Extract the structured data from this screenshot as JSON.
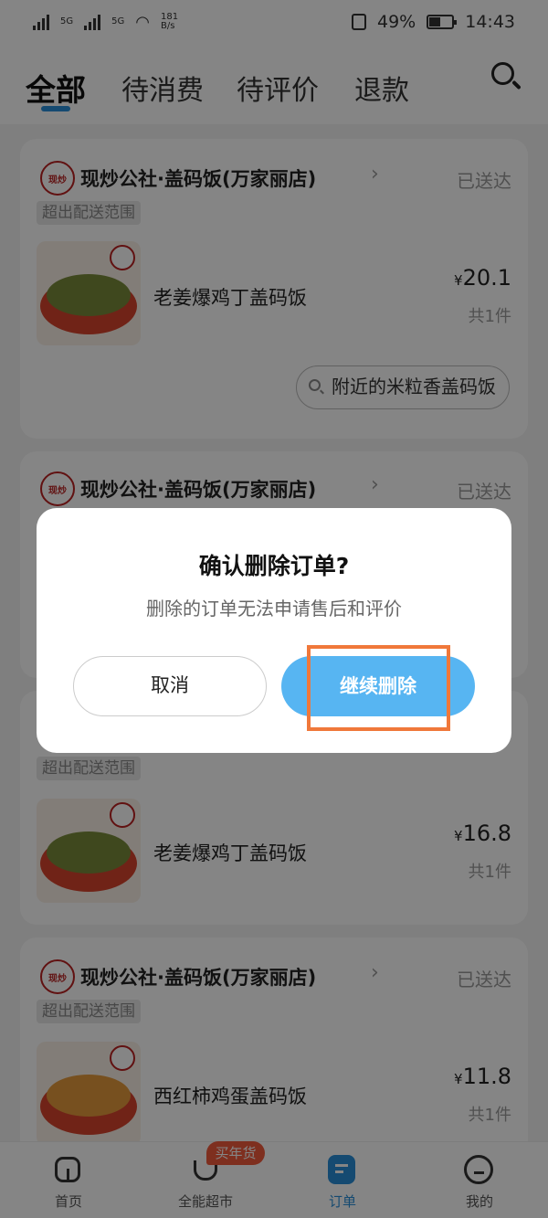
{
  "status_bar": {
    "net1": "5G",
    "net2": "5G",
    "speed_value": "181",
    "speed_unit": "B/s",
    "battery": "49%",
    "time": "14:43"
  },
  "tabs": [
    {
      "label": "全部",
      "active": true
    },
    {
      "label": "待消费",
      "active": false
    },
    {
      "label": "待评价",
      "active": false
    },
    {
      "label": "退款",
      "active": false
    }
  ],
  "orders": [
    {
      "shop": "现炒公社·盖码饭(万家丽店)",
      "status": "已送达",
      "tag": "超出配送范围",
      "dish": "老姜爆鸡丁盖码饭",
      "currency": "¥",
      "price": "20.1",
      "qty": "共1件",
      "action": "附近的米粒香盖码饭"
    },
    {
      "shop": "现炒公社·盖码饭(万家丽店)",
      "status": "已送达"
    },
    {
      "tag": "超出配送范围",
      "dish": "老姜爆鸡丁盖码饭",
      "currency": "¥",
      "price": "16.8",
      "qty": "共1件"
    },
    {
      "shop": "现炒公社·盖码饭(万家丽店)",
      "status": "已送达",
      "tag": "超出配送范围",
      "dish": "西红柿鸡蛋盖码饭",
      "currency": "¥",
      "price": "11.8",
      "qty": "共1件"
    }
  ],
  "bottom_nav": {
    "items": [
      {
        "label": "首页",
        "icon": "home-icon"
      },
      {
        "label": "全能超市",
        "icon": "supermarket-icon"
      },
      {
        "label": "订单",
        "icon": "order-icon",
        "active": true
      },
      {
        "label": "我的",
        "icon": "profile-icon"
      }
    ],
    "badge": "买年货"
  },
  "dialog": {
    "title": "确认删除订单?",
    "message": "删除的订单无法申请售后和评价",
    "cancel_label": "取消",
    "confirm_label": "继续删除"
  },
  "colors": {
    "accent": "#2a8fd8",
    "confirm_button": "#57b5f2",
    "highlight": "#f0783a",
    "badge": "#f25a3c"
  }
}
